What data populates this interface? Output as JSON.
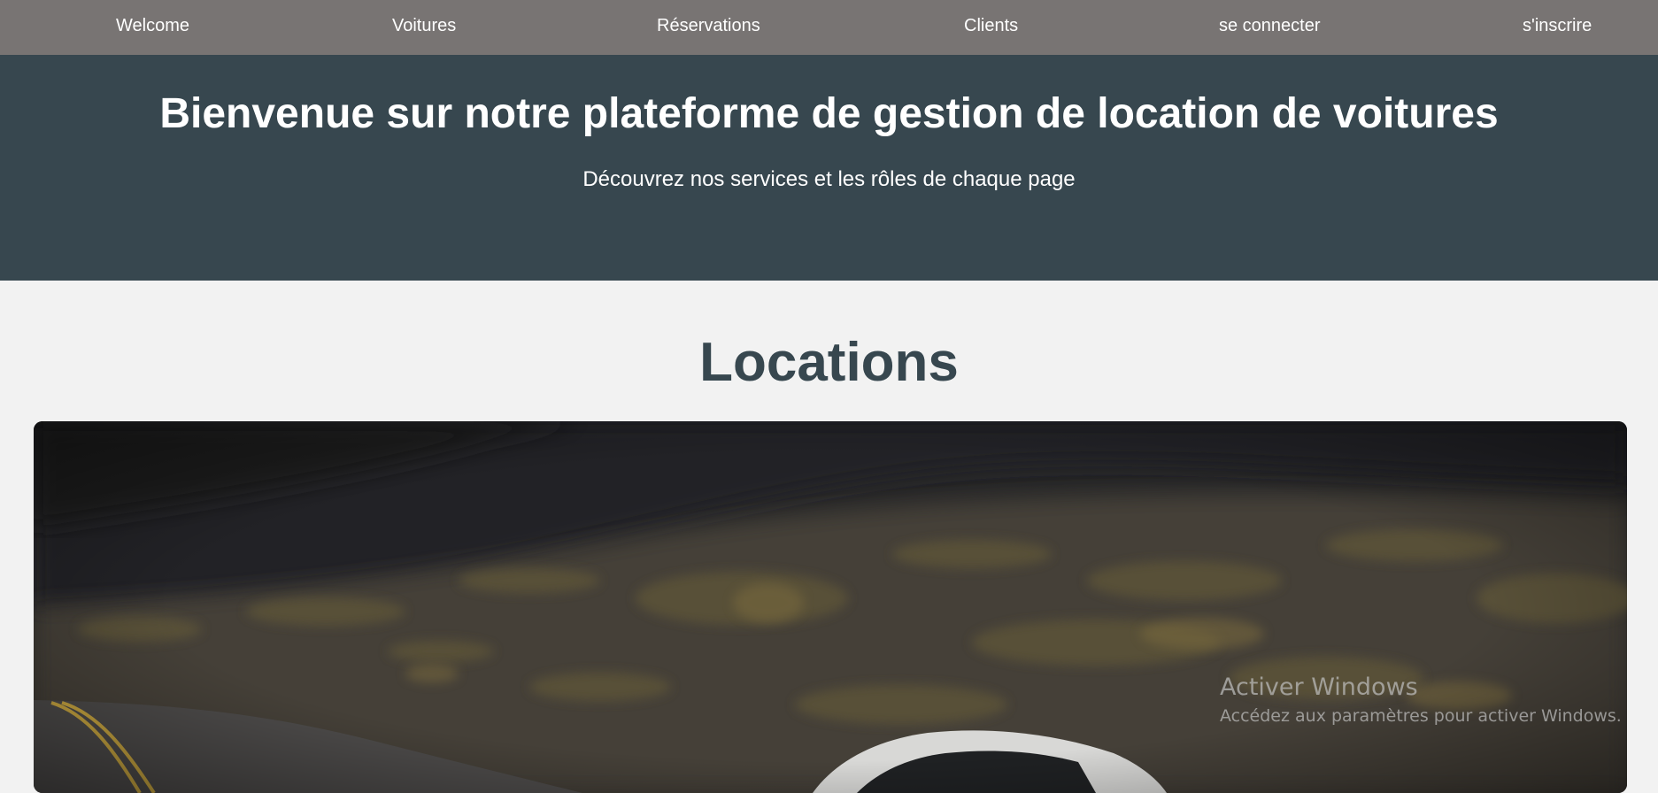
{
  "nav": {
    "items": [
      {
        "label": "Welcome"
      },
      {
        "label": "Voitures"
      },
      {
        "label": "Réservations"
      },
      {
        "label": "Clients"
      },
      {
        "label": "se connecter"
      },
      {
        "label": "s'inscrire"
      }
    ]
  },
  "hero": {
    "title": "Bienvenue sur notre plateforme de gestion de location de voitures",
    "subtitle": "Découvrez nos services et les rôles de chaque page"
  },
  "locations": {
    "title": "Locations"
  },
  "windows_watermark": {
    "title": "Activer Windows",
    "subtitle": "Accédez aux paramètres pour activer Windows."
  },
  "colors": {
    "navbar": "#787473",
    "hero": "#37474f",
    "page_background": "#f2f2f2",
    "section_title": "#37474f"
  }
}
